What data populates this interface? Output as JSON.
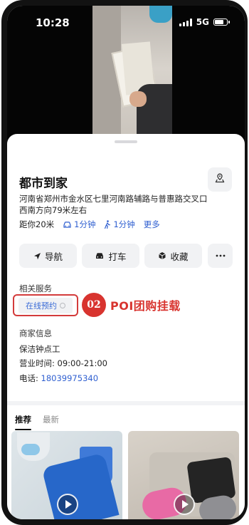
{
  "status_bar": {
    "time": "10:28",
    "network": "5G"
  },
  "place": {
    "name": "都市到家",
    "address": "河南省郑州市金水区七里河南路辅路与普惠路交叉口西南方向79米左右",
    "distance": "距你20米",
    "drive_time": "1分钟",
    "walk_time": "1分钟",
    "more_label": "更多"
  },
  "actions": {
    "navigate": "导航",
    "taxi": "打车",
    "favorite": "收藏"
  },
  "services": {
    "section_title": "相关服务",
    "booking_chip": "在线预约"
  },
  "annotation": {
    "badge": "02",
    "text": "POI团购挂载"
  },
  "merchant": {
    "section_title": "商家信息",
    "service_name": "保洁钟点工",
    "hours": "营业时间: 09:00-21:00",
    "phone_label": "电话: ",
    "phone": "18039975340"
  },
  "feed": {
    "tabs": [
      "推荐",
      "最新"
    ]
  },
  "colors": {
    "accent_blue": "#2f5fd0",
    "annotation_red": "#d8342f"
  }
}
